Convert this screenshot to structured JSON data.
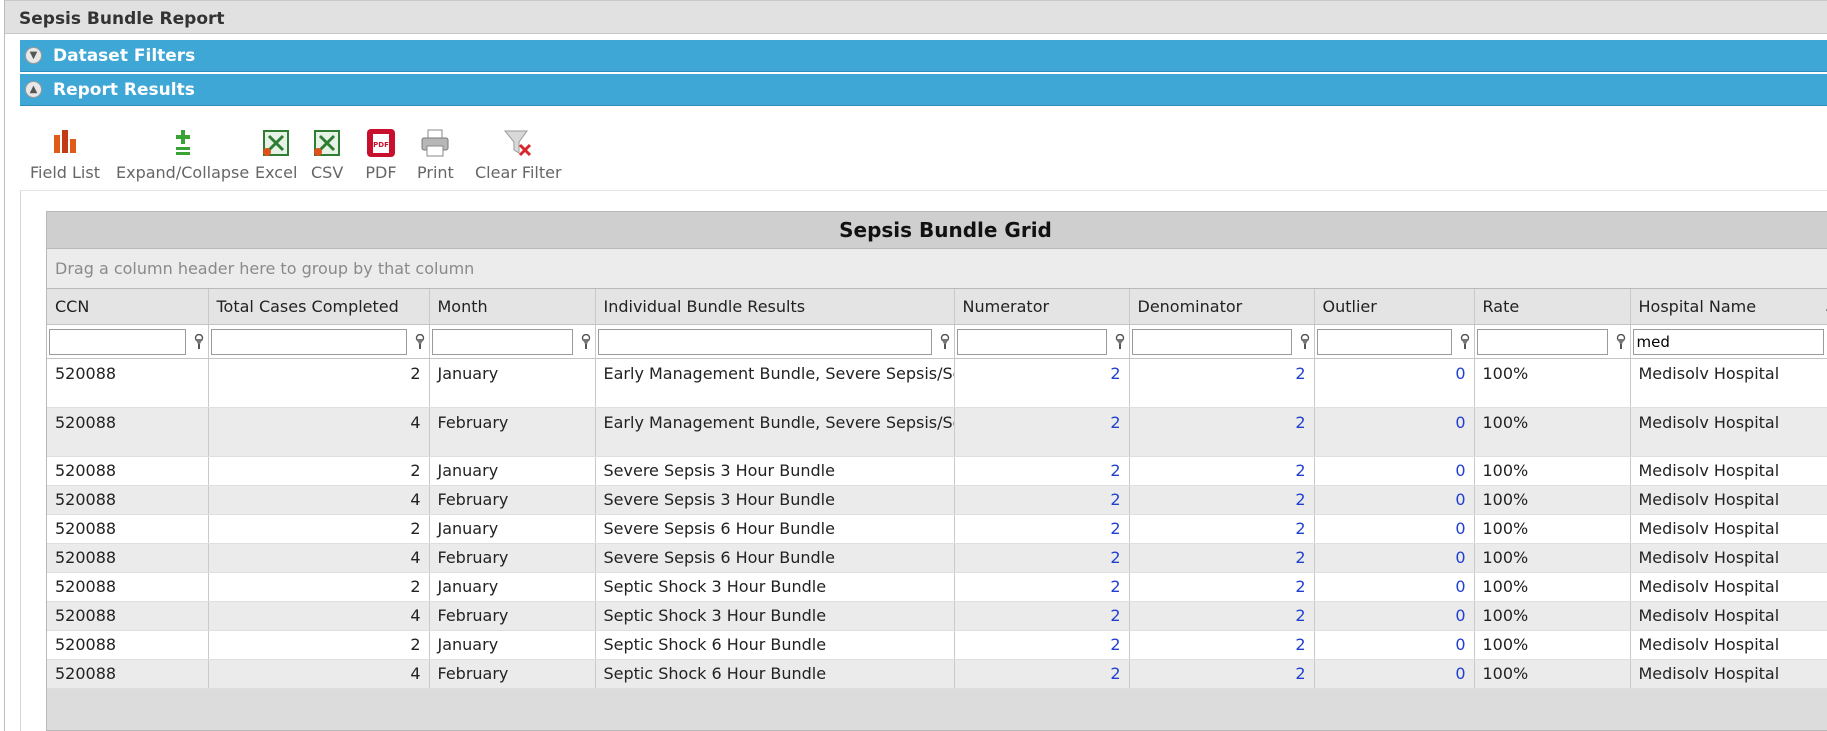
{
  "window": {
    "title": "Sepsis Bundle Report"
  },
  "panels": {
    "dataset_filters": "Dataset Filters",
    "report_results": "Report Results"
  },
  "toolbar": {
    "field_list": "Field List",
    "expand_collapse": "Expand/Collapse",
    "excel": "Excel",
    "csv": "CSV",
    "pdf": "PDF",
    "print": "Print",
    "clear_filter": "Clear Filter",
    "pdf_icon_text": "PDF"
  },
  "grid": {
    "title": "Sepsis Bundle Grid",
    "group_hint": "Drag a column header here to group by that column",
    "columns": [
      "CCN",
      "Total Cases Completed",
      "Month",
      "Individual Bundle Results",
      "Numerator",
      "Denominator",
      "Outlier",
      "Rate",
      "Hospital Name"
    ],
    "filters": [
      "",
      "",
      "",
      "",
      "",
      "",
      "",
      "",
      "med"
    ],
    "rows": [
      [
        "520088",
        "2",
        "January",
        "Early Management Bundle, Severe Sepsis/Septic Shock",
        "2",
        "2",
        "0",
        "100%",
        "Medisolv Hospital"
      ],
      [
        "520088",
        "4",
        "February",
        "Early Management Bundle, Severe Sepsis/Septic Shock",
        "2",
        "2",
        "0",
        "100%",
        "Medisolv Hospital"
      ],
      [
        "520088",
        "2",
        "January",
        "Severe Sepsis 3 Hour Bundle",
        "2",
        "2",
        "0",
        "100%",
        "Medisolv Hospital"
      ],
      [
        "520088",
        "4",
        "February",
        "Severe Sepsis 3 Hour Bundle",
        "2",
        "2",
        "0",
        "100%",
        "Medisolv Hospital"
      ],
      [
        "520088",
        "2",
        "January",
        "Severe Sepsis 6 Hour Bundle",
        "2",
        "2",
        "0",
        "100%",
        "Medisolv Hospital"
      ],
      [
        "520088",
        "4",
        "February",
        "Severe Sepsis 6 Hour Bundle",
        "2",
        "2",
        "0",
        "100%",
        "Medisolv Hospital"
      ],
      [
        "520088",
        "2",
        "January",
        "Septic Shock 3 Hour Bundle",
        "2",
        "2",
        "0",
        "100%",
        "Medisolv Hospital"
      ],
      [
        "520088",
        "4",
        "February",
        "Septic Shock 3 Hour Bundle",
        "2",
        "2",
        "0",
        "100%",
        "Medisolv Hospital"
      ],
      [
        "520088",
        "2",
        "January",
        "Septic Shock 6 Hour Bundle",
        "2",
        "2",
        "0",
        "100%",
        "Medisolv Hospital"
      ],
      [
        "520088",
        "4",
        "February",
        "Septic Shock 6 Hour Bundle",
        "2",
        "2",
        "0",
        "100%",
        "Medisolv Hospital"
      ]
    ]
  },
  "colors": {
    "panel_header": "#3ea7d6",
    "link": "#1f3fd1",
    "title_bar": "#e1e1e1"
  },
  "icons": {
    "panel_collapsed": "chevron-down-circle-icon",
    "panel_expanded": "chevron-up-circle-icon",
    "filter": "funnel-icon",
    "sort": "sort-ascending-icon"
  }
}
